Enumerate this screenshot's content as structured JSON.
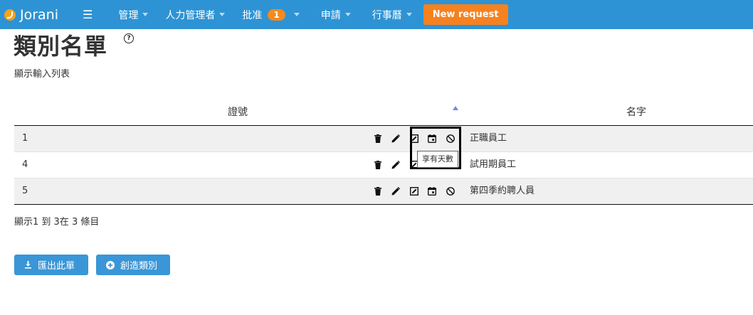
{
  "navbar": {
    "brand": "Jorani",
    "menu": [
      {
        "label": "管理"
      },
      {
        "label": "人力管理者"
      },
      {
        "label": "批准",
        "badge": "1"
      },
      {
        "label": "申請"
      },
      {
        "label": "行事曆"
      }
    ],
    "new_request": "New request"
  },
  "page": {
    "title": "類別名單",
    "subtitle": "顯示輸入列表"
  },
  "table": {
    "headers": {
      "id": "證號",
      "name": "名字"
    },
    "rows": [
      {
        "id": "1",
        "name": "正職員工"
      },
      {
        "id": "4",
        "name": "試用期員工"
      },
      {
        "id": "5",
        "name": "第四季約聘人員"
      }
    ],
    "tooltip": "享有天數",
    "info": "顯示1 到 3在 3 條目"
  },
  "buttons": {
    "export": "匯出此單",
    "create": "創造類別"
  },
  "colors": {
    "navbar": "#2e93d4",
    "accent": "#f6821f",
    "button": "#3a96d6"
  }
}
